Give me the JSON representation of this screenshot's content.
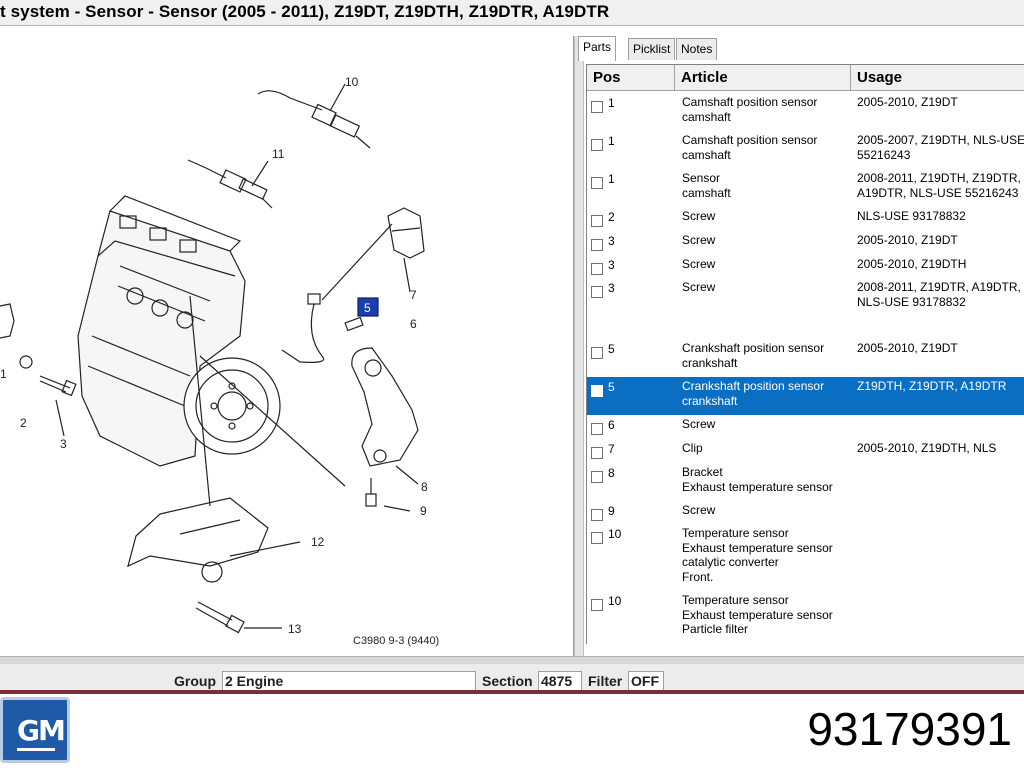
{
  "window": {
    "title": "t system - Sensor - Sensor   (2005 - 2011), Z19DT, Z19DTH, Z19DTR, A19DTR"
  },
  "diagram": {
    "callouts": [
      "10",
      "11",
      "7",
      "5",
      "6",
      "1",
      "2",
      "3",
      "8",
      "9",
      "12",
      "13"
    ],
    "caption": "C3980 9-3 (9440)"
  },
  "tabs": [
    {
      "label": "Parts"
    },
    {
      "label": "Picklist"
    },
    {
      "label": "Notes"
    }
  ],
  "table": {
    "headers": [
      "Pos",
      "Article",
      "Usage"
    ],
    "selected_row": 8,
    "rows": [
      {
        "pos": "1",
        "article": "Camshaft position sensor\ncamshaft",
        "usage": "2005-2010, Z19DT"
      },
      {
        "pos": "1",
        "article": "Camshaft position sensor\ncamshaft",
        "usage": "2005-2007, Z19DTH, NLS-USE\n55216243"
      },
      {
        "pos": "1",
        "article": "Sensor\ncamshaft",
        "usage": "2008-2011, Z19DTH, Z19DTR,\nA19DTR, NLS-USE 55216243"
      },
      {
        "pos": "2",
        "article": "Screw",
        "usage": "NLS-USE 93178832"
      },
      {
        "pos": "3",
        "article": "Screw",
        "usage": "2005-2010, Z19DT"
      },
      {
        "pos": "3",
        "article": "Screw",
        "usage": "2005-2010, Z19DTH"
      },
      {
        "pos": "3",
        "article": "Screw",
        "usage": "2008-2011, Z19DTR, A19DTR,\nNLS-USE 93178832"
      },
      {
        "pos": "5",
        "article": "Crankshaft position sensor\ncrankshaft",
        "usage": "2005-2010, Z19DT"
      },
      {
        "pos": "5",
        "article": "Crankshaft position sensor\ncrankshaft",
        "usage": "Z19DTH, Z19DTR, A19DTR"
      },
      {
        "pos": "6",
        "article": "Screw",
        "usage": ""
      },
      {
        "pos": "7",
        "article": "Clip",
        "usage": "2005-2010, Z19DTH, NLS"
      },
      {
        "pos": "8",
        "article": "Bracket\nExhaust temperature sensor",
        "usage": ""
      },
      {
        "pos": "9",
        "article": "Screw",
        "usage": ""
      },
      {
        "pos": "10",
        "article": "Temperature sensor\nExhaust temperature sensor\ncatalytic converter\nFront.",
        "usage": ""
      },
      {
        "pos": "10",
        "article": "Temperature sensor\nExhaust temperature sensor\nParticle filter",
        "usage": ""
      }
    ]
  },
  "statusbar": {
    "group_label": "Group",
    "group_value": "2 Engine",
    "section_label": "Section",
    "section_value": "4875",
    "filter_label": "Filter",
    "filter_value": "OFF"
  },
  "footer": {
    "logo_text": "GM",
    "part_number": "93179391"
  },
  "colors": {
    "selection": "#0a6fc3",
    "callout_highlight": "#1a3fa8",
    "logo_blue": "#1e5aa8"
  }
}
